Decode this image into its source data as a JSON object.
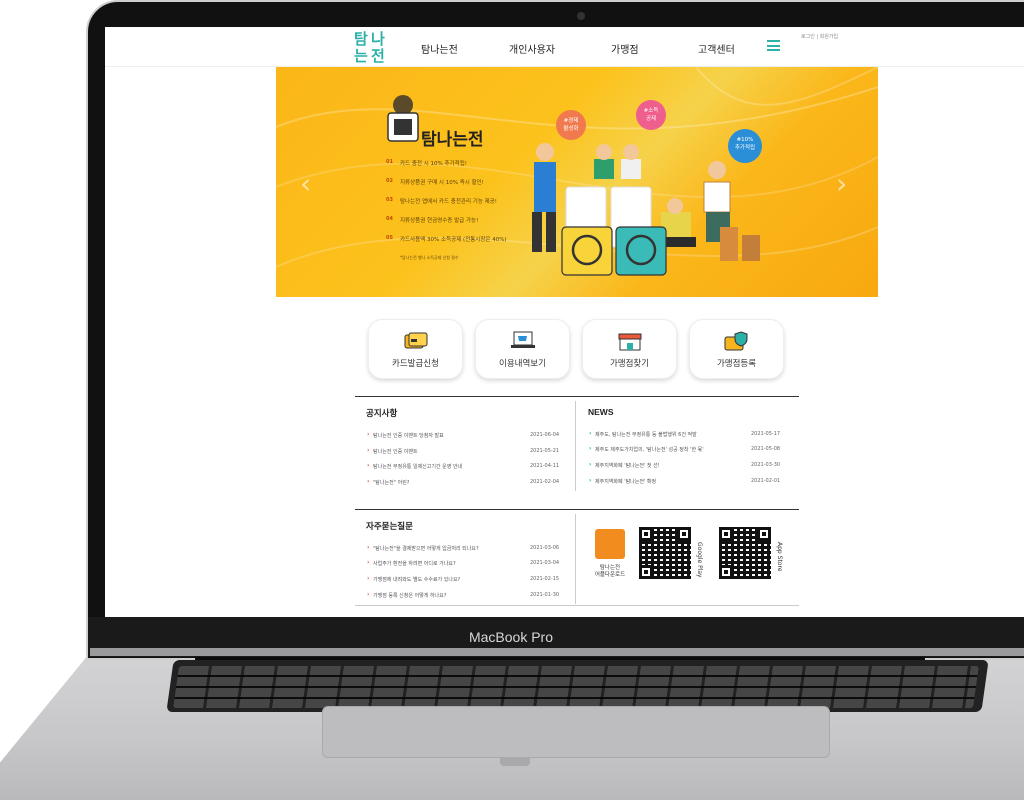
{
  "device": {
    "brand_label": "MacBook Pro"
  },
  "site": {
    "logo_text": [
      "탐",
      "나",
      "는",
      "전"
    ],
    "nav": [
      "탐나는전",
      "개인사용자",
      "가맹점",
      "고객센터"
    ],
    "util_links": "로그인 | 회원가입"
  },
  "hero": {
    "title": "탐나는전",
    "list": [
      {
        "num": "01",
        "text": "카드 충전 시 10% 추가적립!"
      },
      {
        "num": "02",
        "text": "지류상품권 구매 시 10% 즉시 할인!"
      },
      {
        "num": "03",
        "text": "탐나는전 앱에서 카드 충전관리 기능 제공!"
      },
      {
        "num": "04",
        "text": "지류상품권 현금영수증 발급 가능!"
      },
      {
        "num": "05",
        "text": "카드사용액 30% 소득공제 (전통시장은 40%)"
      }
    ],
    "sub_note": "*탐나는전 행나 소득공제 신청 필수",
    "bubbles": [
      {
        "text": "#경제\n활성화",
        "color": "#f07a4d"
      },
      {
        "text": "#소득\n공제",
        "color": "#ef5f8d"
      },
      {
        "text": "#10%\n추가적립",
        "color": "#2a8fd6"
      }
    ],
    "arrow_left": "‹",
    "arrow_right": "›"
  },
  "quick": [
    {
      "label": "카드발급신청",
      "icon": "card-icon"
    },
    {
      "label": "이용내역보기",
      "icon": "laptop-cart-icon"
    },
    {
      "label": "가맹점찾기",
      "icon": "store-icon"
    },
    {
      "label": "가맹점등록",
      "icon": "card-shield-icon"
    }
  ],
  "notice": {
    "title": "공지사항",
    "rows": [
      {
        "text": "탐나는전 인증 이벤트 당첨자 발표",
        "date": "2021-06-04"
      },
      {
        "text": "탐나는전 인증 이벤트",
        "date": "2021-05-21"
      },
      {
        "text": "탐나는전 부정유통 일제신고기간 운영 안내",
        "date": "2021-04-11"
      },
      {
        "text": "\"탐나는전\" 어린?",
        "date": "2021-02-04"
      }
    ]
  },
  "news": {
    "title": "NEWS",
    "rows": [
      {
        "text": "제주도, 탐나는전 부정유통 등 불법행위 6건 적발",
        "date": "2021-05-17"
      },
      {
        "text": "제주도 제주도가치업의, '탐나는전' 성공 정착 '한 몫'",
        "date": "2021-05-08"
      },
      {
        "text": "제주지역화폐 '탐나는전' 첫 선!",
        "date": "2021-03-30"
      },
      {
        "text": "제주지역화폐 '탐나는전' 확정",
        "date": "2021-02-01"
      }
    ]
  },
  "faq": {
    "title": "자주묻는질문",
    "rows": [
      {
        "text": "\"탐나는전\"을 결제받으면 어떻게 입금처리 되나요?",
        "date": "2021-03-06"
      },
      {
        "text": "사업주가 환전을 하려면 어디로 가나요?",
        "date": "2021-03-04"
      },
      {
        "text": "가맹점에 내려와도 별도 수수료가 있나요?",
        "date": "2021-02-15"
      },
      {
        "text": "가맹점 등록 신청은 어떻게 하나요?",
        "date": "2021-01-30"
      }
    ]
  },
  "app": {
    "label_line1": "탐나는전",
    "label_line2": "어플다운로드",
    "stores": [
      "Google Play",
      "App Store"
    ]
  }
}
